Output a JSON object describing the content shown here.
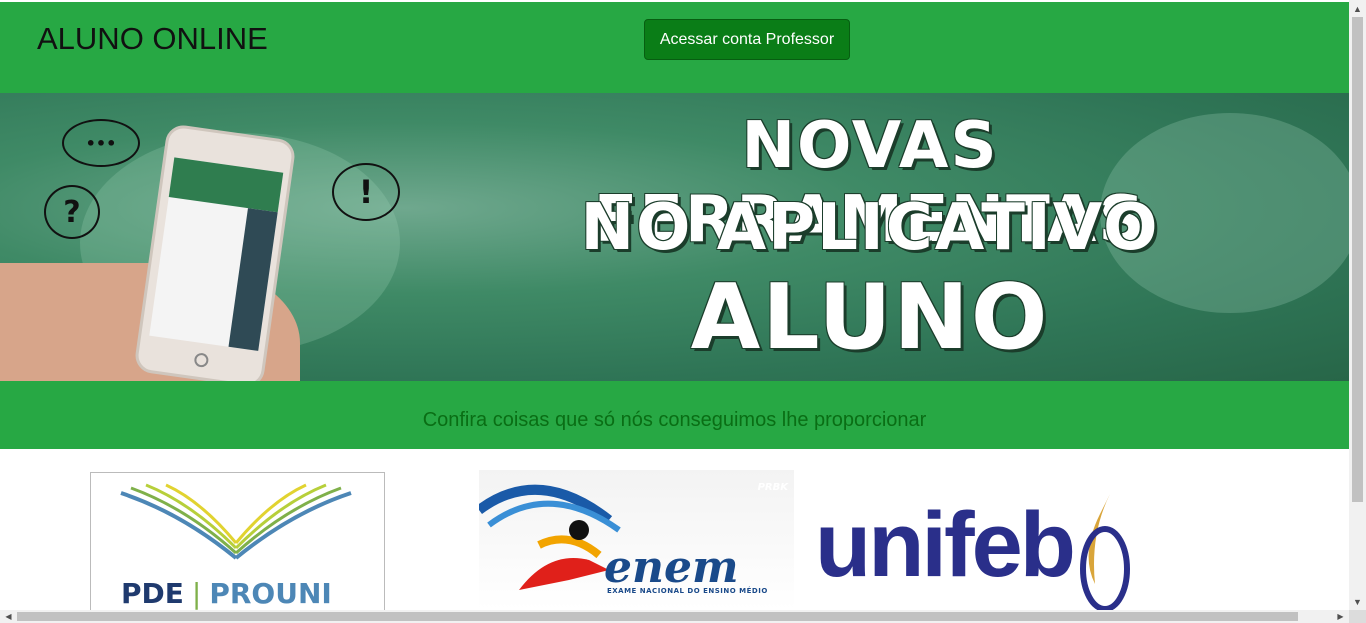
{
  "header": {
    "brand": "ALUNO ONLINE",
    "professor_button": "Acessar conta Professor",
    "background_color": "#27a844",
    "button_color": "#0a7d17"
  },
  "banner": {
    "line1": "NOVAS FERRAMENTAS",
    "line2": "NO APLICATIVO",
    "line3": "ALUNO ONLINE",
    "bubble_question": "?",
    "bubble_exclaim": "!",
    "bubble_dots": "•••"
  },
  "subheader": {
    "text": "Confira coisas que só nós conseguimos lhe proporcionar"
  },
  "logos": {
    "prouni": {
      "left": "PDE",
      "sep": "|",
      "right": "PROUNI"
    },
    "enem": {
      "name": "enem",
      "subtitle": "EXAME NACIONAL DO ENSINO MÉDIO",
      "tag": "PRBK"
    },
    "unifeb": {
      "name": "unifeb"
    }
  },
  "scrollbars": {
    "up_arrow": "▲",
    "down_arrow": "▼",
    "left_arrow": "◀",
    "right_arrow": "▶"
  }
}
